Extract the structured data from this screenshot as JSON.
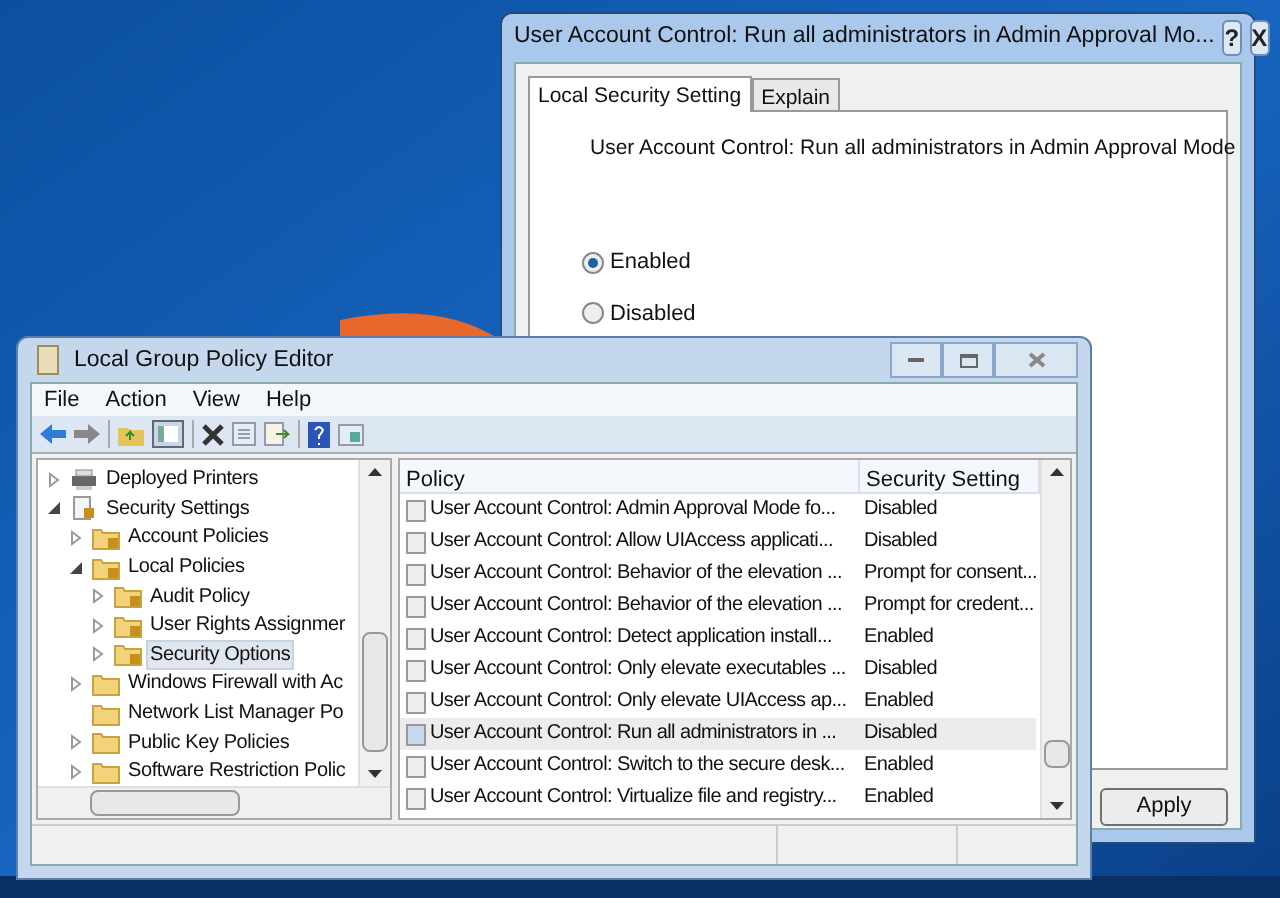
{
  "dialog": {
    "title": "User Account Control: Run all administrators in Admin Approval Mo...",
    "help_button": "?",
    "close_button": "X",
    "tabs": [
      {
        "label": "Local Security Setting",
        "selected": true
      },
      {
        "label": "Explain",
        "selected": false
      }
    ],
    "policy_name": "User Account Control: Run all administrators in Admin Approval Mode",
    "options": [
      {
        "label": "Enabled",
        "selected": true
      },
      {
        "label": "Disabled",
        "selected": false
      }
    ],
    "buttons": [
      "Apply"
    ]
  },
  "editor": {
    "title": "Local Group Policy Editor",
    "menu": [
      "File",
      "Action",
      "View",
      "Help"
    ],
    "tree": [
      {
        "label": "Deployed Printers",
        "kind": "printer",
        "expanded": false,
        "selected": false
      },
      {
        "label": "Security Settings",
        "kind": "shield",
        "expanded": true,
        "selected": false,
        "children": [
          {
            "label": "Account Policies",
            "kind": "locked-folder",
            "expanded": false,
            "selected": false
          },
          {
            "label": "Local Policies",
            "kind": "locked-folder",
            "expanded": true,
            "selected": false,
            "children": [
              {
                "label": "Audit Policy",
                "kind": "locked-folder",
                "expanded": false,
                "selected": false
              },
              {
                "label": "User Rights Assignmer",
                "kind": "locked-folder",
                "expanded": false,
                "selected": false
              },
              {
                "label": "Security Options",
                "kind": "locked-folder",
                "expanded": false,
                "selected": true
              }
            ]
          },
          {
            "label": "Windows Firewall with Ac",
            "kind": "folder",
            "expanded": false,
            "selected": false
          },
          {
            "label": "Network List Manager Po",
            "kind": "folder",
            "selected": false
          },
          {
            "label": "Public Key Policies",
            "kind": "folder",
            "expanded": false,
            "selected": false
          },
          {
            "label": "Software Restriction Polic",
            "kind": "folder",
            "expanded": false,
            "selected": false
          }
        ]
      }
    ],
    "table": {
      "columns": [
        "Policy",
        "Security Setting"
      ],
      "rows": [
        {
          "policy": "User Account Control: Admin Approval Mode fo...",
          "setting": "Disabled",
          "selected": false
        },
        {
          "policy": "User Account Control: Allow UIAccess applicati...",
          "setting": "Disabled",
          "selected": false
        },
        {
          "policy": "User Account Control: Behavior of the elevation ...",
          "setting": "Prompt for consent...",
          "selected": false
        },
        {
          "policy": "User Account Control: Behavior of the elevation ...",
          "setting": "Prompt for credent...",
          "selected": false
        },
        {
          "policy": "User Account Control: Detect application install...",
          "setting": "Enabled",
          "selected": false
        },
        {
          "policy": "User Account Control: Only elevate executables ...",
          "setting": "Disabled",
          "selected": false
        },
        {
          "policy": "User Account Control: Only elevate UIAccess ap...",
          "setting": "Enabled",
          "selected": false
        },
        {
          "policy": "User Account Control: Run all administrators in ...",
          "setting": "Disabled",
          "selected": true
        },
        {
          "policy": "User Account Control: Switch to the secure desk...",
          "setting": "Enabled",
          "selected": false
        },
        {
          "policy": "User Account Control: Virtualize file and registry...",
          "setting": "Enabled",
          "selected": false
        }
      ]
    }
  }
}
